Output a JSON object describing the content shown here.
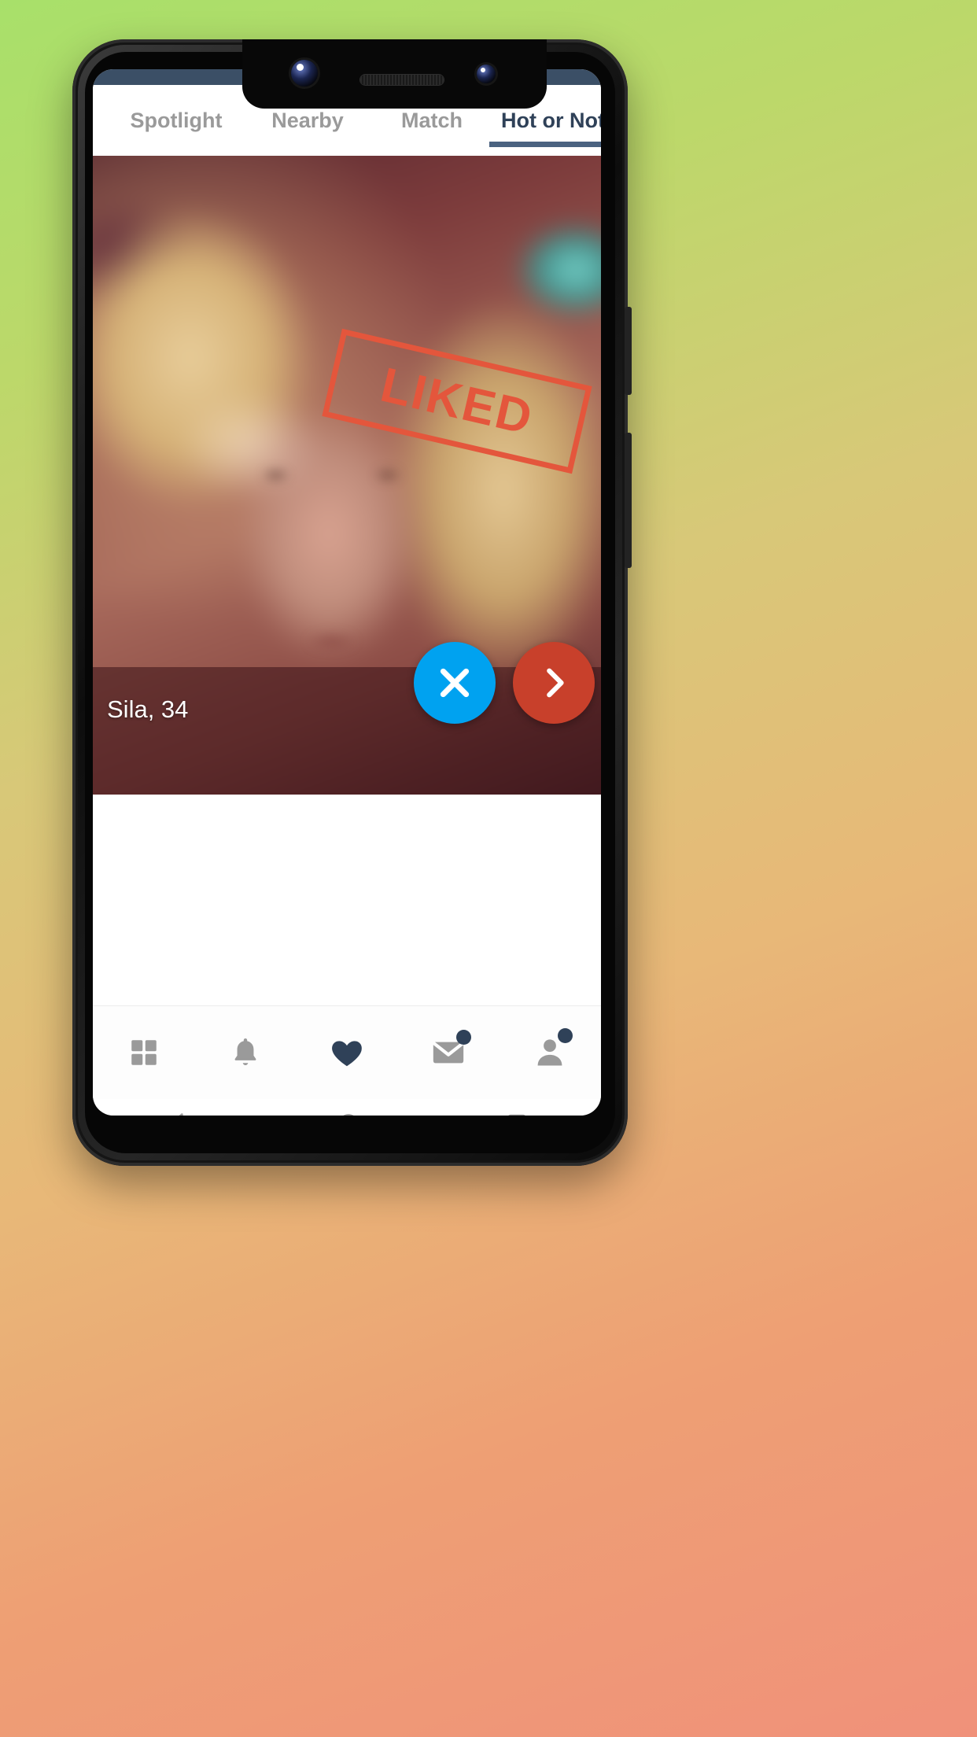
{
  "app": {
    "tabs": [
      {
        "label": "Spotlight",
        "name": "tab-spotlight",
        "active": false
      },
      {
        "label": "Nearby",
        "name": "tab-nearby",
        "active": false
      },
      {
        "label": "Match",
        "name": "tab-match",
        "active": false
      },
      {
        "label": "Hot or Not",
        "name": "tab-hotornot",
        "active": true
      }
    ],
    "active_tab": "Hot or Not"
  },
  "card": {
    "name_age": "Sila, 34",
    "stamp_label": "LIKED",
    "stamp_color": "#e4563c",
    "actions": [
      {
        "name": "dislike-button",
        "icon": "close-icon",
        "color": "#00a2f0"
      },
      {
        "name": "next-button",
        "icon": "chevron-right-icon",
        "color": "#c8402b"
      }
    ]
  },
  "bottom_nav": {
    "items": [
      {
        "name": "nav-item-grid",
        "icon": "grid-icon",
        "active": false,
        "badge": false
      },
      {
        "name": "nav-item-alerts",
        "icon": "bell-icon",
        "active": false,
        "badge": false
      },
      {
        "name": "nav-item-likes",
        "icon": "heart-icon",
        "active": true,
        "badge": false
      },
      {
        "name": "nav-item-messages",
        "icon": "mail-icon",
        "active": false,
        "badge": true
      },
      {
        "name": "nav-item-profile",
        "icon": "person-icon",
        "active": false,
        "badge": true
      }
    ],
    "inactive_color": "#9a9a9a",
    "active_color": "#2f4158",
    "badge_color": "#2f4158"
  },
  "system_nav": {
    "items": [
      {
        "name": "android-back-button",
        "icon": "triangle-back-icon"
      },
      {
        "name": "android-home-button",
        "icon": "circle-home-icon"
      },
      {
        "name": "android-recents-button",
        "icon": "square-recents-icon"
      }
    ]
  },
  "status_bar": {
    "color": "#3b4f66"
  }
}
